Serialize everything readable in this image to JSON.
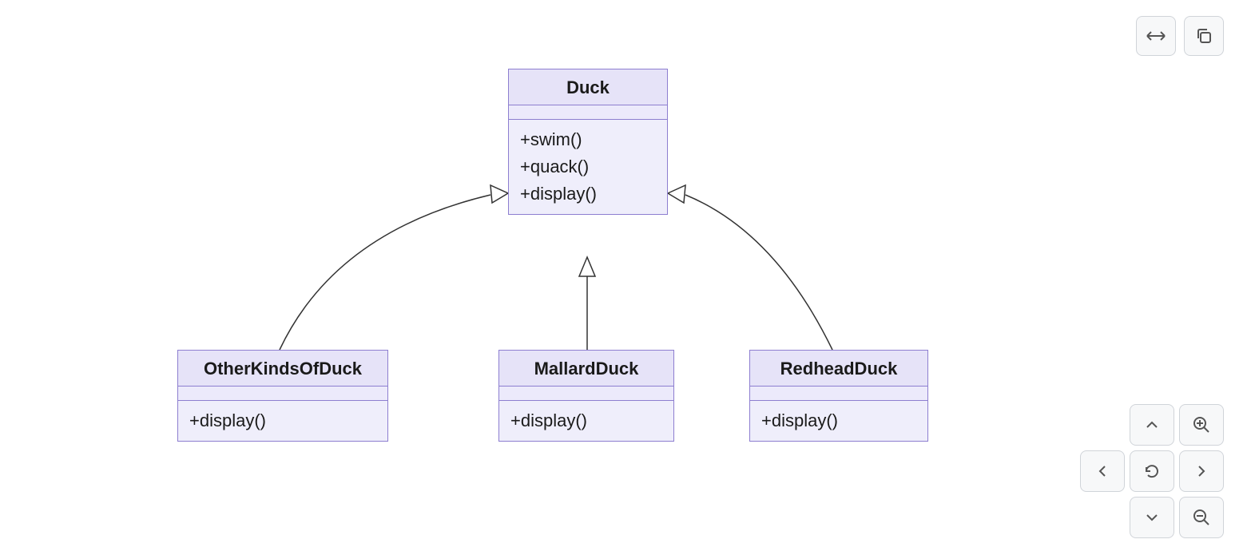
{
  "toolbar": {
    "width_icon": "arrows-horizontal-icon",
    "copy_icon": "copy-icon"
  },
  "pad": {
    "up": "chevron-up-icon",
    "down": "chevron-down-icon",
    "left": "chevron-left-icon",
    "right": "chevron-right-icon",
    "reset": "refresh-icon",
    "zoom_in": "zoom-in-icon",
    "zoom_out": "zoom-out-icon"
  },
  "classes": {
    "duck": {
      "name": "Duck",
      "methods": [
        "+swim()",
        "+quack()",
        "+display()"
      ]
    },
    "other": {
      "name": "OtherKindsOfDuck",
      "methods": [
        "+display()"
      ]
    },
    "mallard": {
      "name": "MallardDuck",
      "methods": [
        "+display()"
      ]
    },
    "redhead": {
      "name": "RedheadDuck",
      "methods": [
        "+display()"
      ]
    }
  }
}
